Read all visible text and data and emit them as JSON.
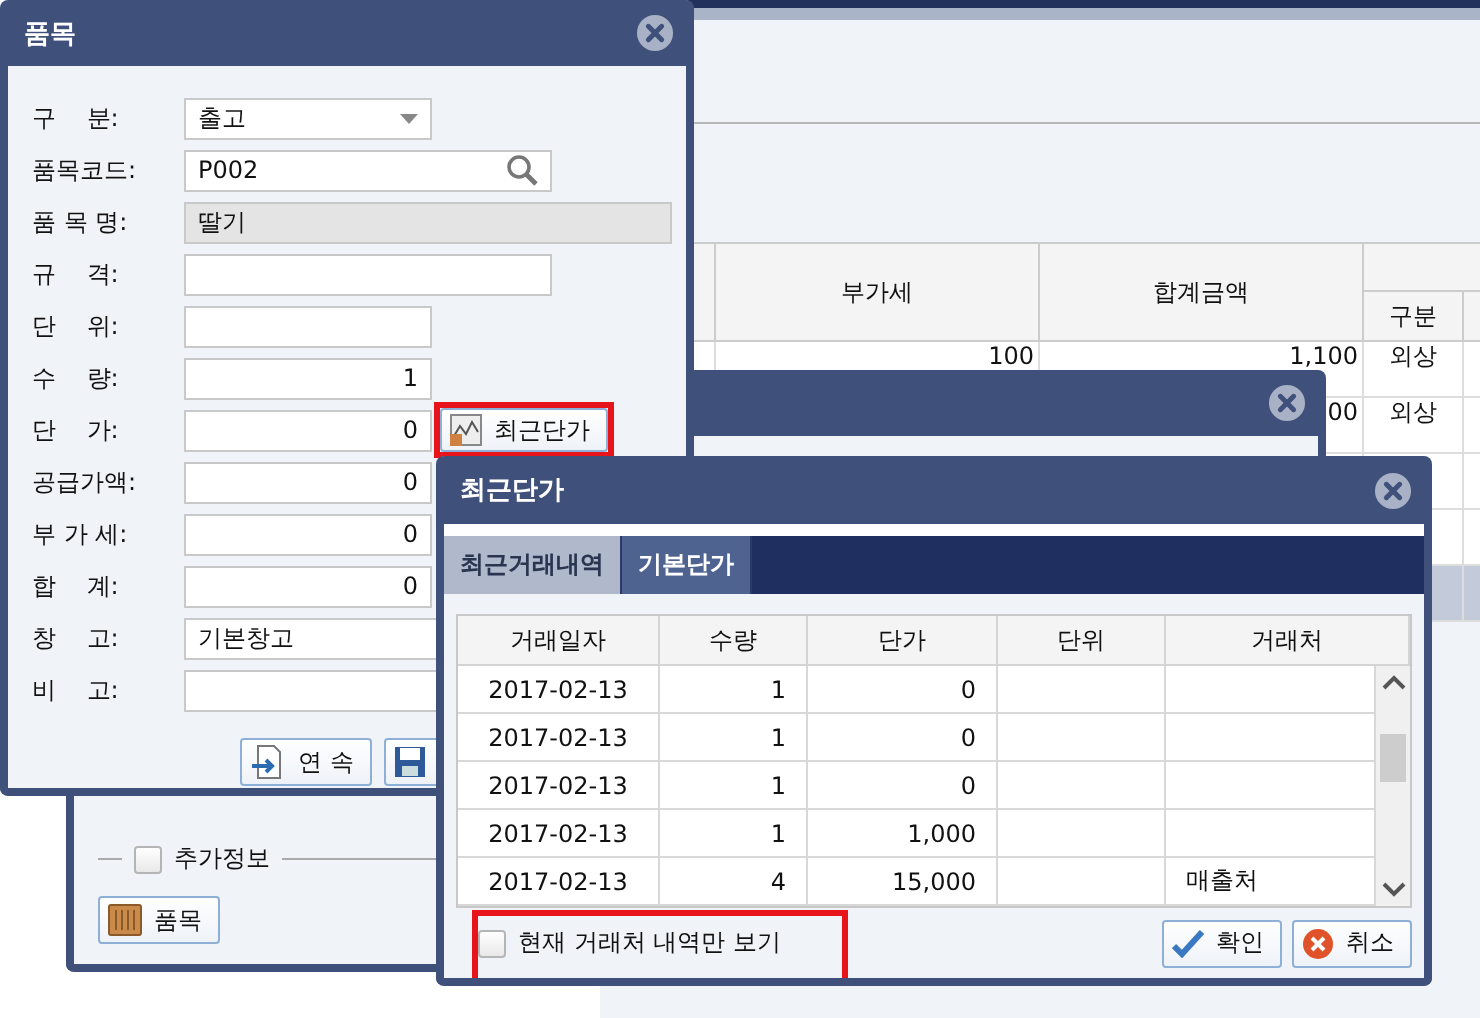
{
  "main_window": {
    "table": {
      "columns": [
        {
          "label": "부가세"
        },
        {
          "label": "합계금액"
        },
        {
          "label": "구분"
        }
      ],
      "rows": [
        {
          "vat": "100",
          "total": "1,100",
          "type": "외상",
          "selected": false
        },
        {
          "total": "00",
          "type": "외상",
          "selected": false
        },
        {
          "selected": false
        },
        {
          "selected": false
        },
        {
          "selected": true
        }
      ]
    }
  },
  "form_window": {
    "title": "품목",
    "fields": [
      {
        "label": "구    분:",
        "kind": "dropdown",
        "value": "출고"
      },
      {
        "label": "품목코드:",
        "kind": "search",
        "value": "P002"
      },
      {
        "label": "품 목 명:",
        "kind": "readonly",
        "value": "딸기"
      },
      {
        "label": "규    격:",
        "kind": "text"
      },
      {
        "label": "단    위:",
        "kind": "text"
      },
      {
        "label": "수    량:",
        "kind": "number",
        "value": "1"
      },
      {
        "label": "단    가:",
        "kind": "number",
        "value": "0",
        "button": {
          "label": "최근단가",
          "highlighted": true
        }
      },
      {
        "label": "공급가액:",
        "kind": "number",
        "value": "0"
      },
      {
        "label": "부 가 세:",
        "kind": "number",
        "value": "0"
      },
      {
        "label": "합    계:",
        "kind": "number",
        "value": "0"
      },
      {
        "label": "창    고:",
        "kind": "text",
        "value": "기본창고"
      },
      {
        "label": "비    고:",
        "kind": "text"
      }
    ],
    "buttons": [
      {
        "kind": "continue",
        "label": "연 속"
      },
      {
        "kind": "save"
      }
    ]
  },
  "background_dialog": {
    "extra_info": {
      "label": "추가정보",
      "checked": false
    },
    "item_button": {
      "label": "품목"
    }
  },
  "price_dialog": {
    "title": "최근단가",
    "tabs": [
      {
        "label": "최근거래내역",
        "selected": true
      },
      {
        "label": "기본단가",
        "selected": false
      }
    ],
    "table": {
      "columns": [
        "거래일자",
        "수량",
        "단가",
        "단위",
        "거래처"
      ],
      "rows": [
        {
          "date": "2017-02-13",
          "qty": "1",
          "price": "0"
        },
        {
          "date": "2017-02-13",
          "qty": "1",
          "price": "0"
        },
        {
          "date": "2017-02-13",
          "qty": "1",
          "price": "0"
        },
        {
          "date": "2017-02-13",
          "qty": "1",
          "price": "1,000"
        },
        {
          "date": "2017-02-13",
          "qty": "4",
          "price": "15,000",
          "partner": "매출처"
        }
      ]
    },
    "filter": {
      "label": "현재 거래처 내역만 보기",
      "checked": false,
      "highlighted": true
    },
    "buttons": [
      {
        "kind": "ok",
        "label": "확인"
      },
      {
        "kind": "cancel",
        "label": "취소"
      }
    ]
  }
}
